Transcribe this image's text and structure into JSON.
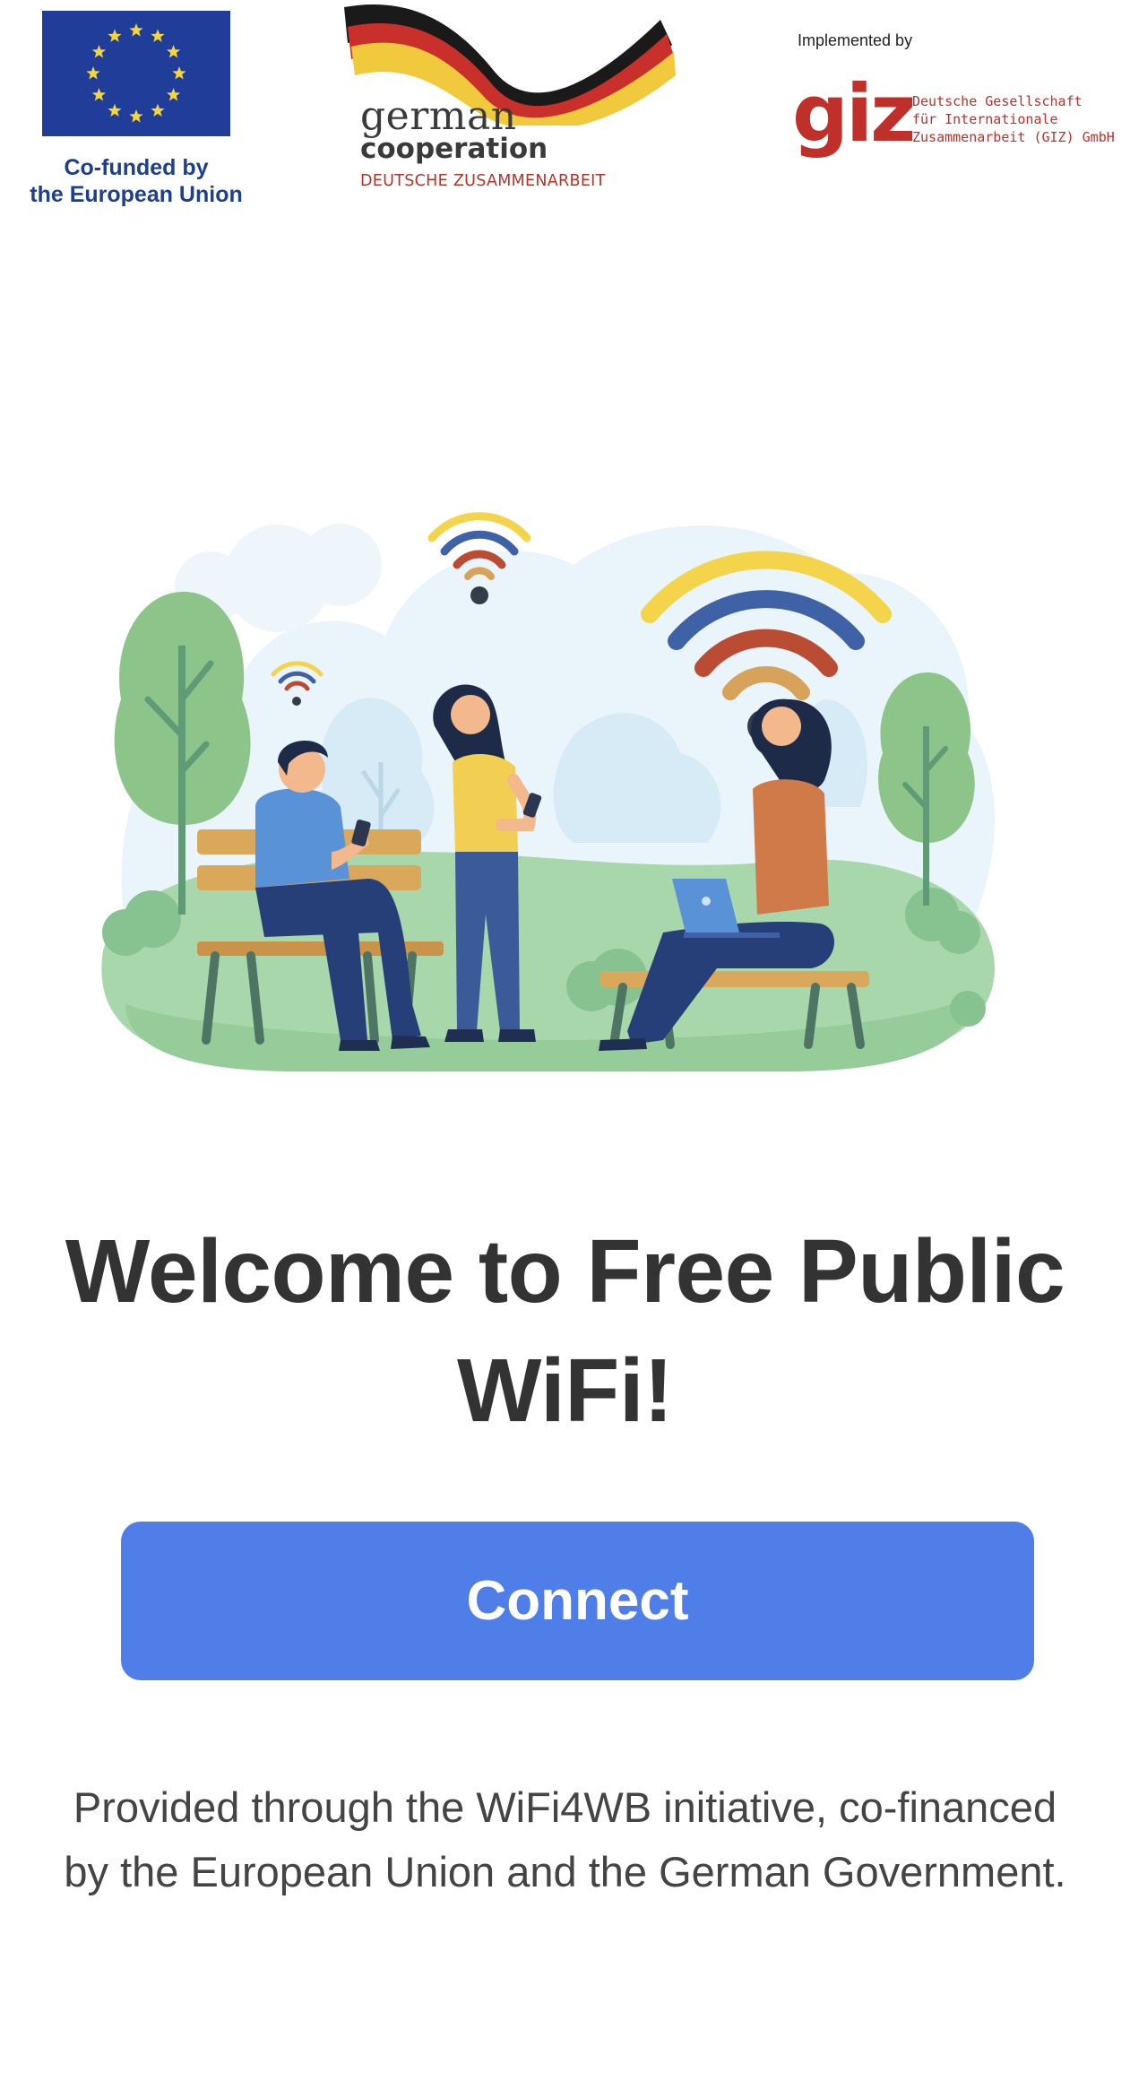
{
  "header": {
    "eu_logo": {
      "caption_line1": "Co-funded by",
      "caption_line2": "the European Union",
      "flag_color": "#1f3d99",
      "star_color": "#f5d53a"
    },
    "german_cooperation_logo": {
      "line1": "german",
      "line2": "cooperation",
      "line3": "DEUTSCHE ZUSAMMENARBEIT"
    },
    "giz_logo": {
      "implemented_by": "Implemented by",
      "mark": "giz",
      "line1": "Deutsche Gesellschaft",
      "line2": "für Internationale",
      "line3": "Zusammenarbeit (GIZ) GmbH",
      "brand_color": "#c0302a"
    }
  },
  "illustration": {
    "icon": "people-using-public-wifi-in-park-illustration"
  },
  "main": {
    "title": "Welcome to Free Public WiFi!",
    "connect_label": "Connect",
    "accent_color": "#4f7ee8"
  },
  "footer": {
    "note": "Provided through the WiFi4WB initiative, co-financed by the European Union and the German Government."
  }
}
